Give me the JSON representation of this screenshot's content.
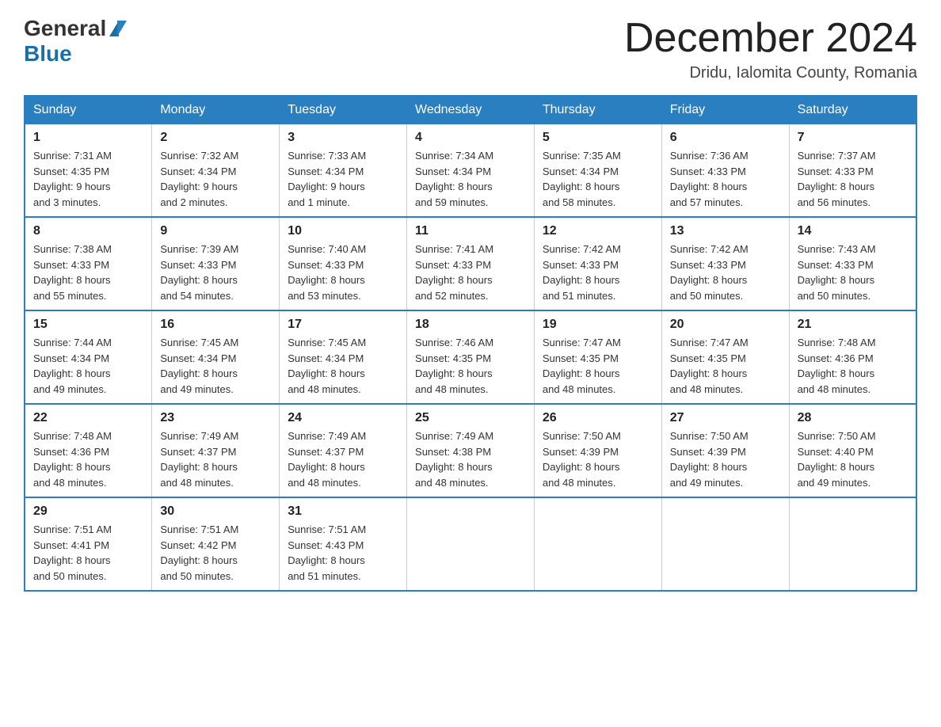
{
  "logo": {
    "general": "General",
    "blue": "Blue"
  },
  "title": "December 2024",
  "subtitle": "Dridu, Ialomita County, Romania",
  "weekdays": [
    "Sunday",
    "Monday",
    "Tuesday",
    "Wednesday",
    "Thursday",
    "Friday",
    "Saturday"
  ],
  "weeks": [
    [
      {
        "day": "1",
        "sunrise": "7:31 AM",
        "sunset": "4:35 PM",
        "daylight": "9 hours and 3 minutes."
      },
      {
        "day": "2",
        "sunrise": "7:32 AM",
        "sunset": "4:34 PM",
        "daylight": "9 hours and 2 minutes."
      },
      {
        "day": "3",
        "sunrise": "7:33 AM",
        "sunset": "4:34 PM",
        "daylight": "9 hours and 1 minute."
      },
      {
        "day": "4",
        "sunrise": "7:34 AM",
        "sunset": "4:34 PM",
        "daylight": "8 hours and 59 minutes."
      },
      {
        "day": "5",
        "sunrise": "7:35 AM",
        "sunset": "4:34 PM",
        "daylight": "8 hours and 58 minutes."
      },
      {
        "day": "6",
        "sunrise": "7:36 AM",
        "sunset": "4:33 PM",
        "daylight": "8 hours and 57 minutes."
      },
      {
        "day": "7",
        "sunrise": "7:37 AM",
        "sunset": "4:33 PM",
        "daylight": "8 hours and 56 minutes."
      }
    ],
    [
      {
        "day": "8",
        "sunrise": "7:38 AM",
        "sunset": "4:33 PM",
        "daylight": "8 hours and 55 minutes."
      },
      {
        "day": "9",
        "sunrise": "7:39 AM",
        "sunset": "4:33 PM",
        "daylight": "8 hours and 54 minutes."
      },
      {
        "day": "10",
        "sunrise": "7:40 AM",
        "sunset": "4:33 PM",
        "daylight": "8 hours and 53 minutes."
      },
      {
        "day": "11",
        "sunrise": "7:41 AM",
        "sunset": "4:33 PM",
        "daylight": "8 hours and 52 minutes."
      },
      {
        "day": "12",
        "sunrise": "7:42 AM",
        "sunset": "4:33 PM",
        "daylight": "8 hours and 51 minutes."
      },
      {
        "day": "13",
        "sunrise": "7:42 AM",
        "sunset": "4:33 PM",
        "daylight": "8 hours and 50 minutes."
      },
      {
        "day": "14",
        "sunrise": "7:43 AM",
        "sunset": "4:33 PM",
        "daylight": "8 hours and 50 minutes."
      }
    ],
    [
      {
        "day": "15",
        "sunrise": "7:44 AM",
        "sunset": "4:34 PM",
        "daylight": "8 hours and 49 minutes."
      },
      {
        "day": "16",
        "sunrise": "7:45 AM",
        "sunset": "4:34 PM",
        "daylight": "8 hours and 49 minutes."
      },
      {
        "day": "17",
        "sunrise": "7:45 AM",
        "sunset": "4:34 PM",
        "daylight": "8 hours and 48 minutes."
      },
      {
        "day": "18",
        "sunrise": "7:46 AM",
        "sunset": "4:35 PM",
        "daylight": "8 hours and 48 minutes."
      },
      {
        "day": "19",
        "sunrise": "7:47 AM",
        "sunset": "4:35 PM",
        "daylight": "8 hours and 48 minutes."
      },
      {
        "day": "20",
        "sunrise": "7:47 AM",
        "sunset": "4:35 PM",
        "daylight": "8 hours and 48 minutes."
      },
      {
        "day": "21",
        "sunrise": "7:48 AM",
        "sunset": "4:36 PM",
        "daylight": "8 hours and 48 minutes."
      }
    ],
    [
      {
        "day": "22",
        "sunrise": "7:48 AM",
        "sunset": "4:36 PM",
        "daylight": "8 hours and 48 minutes."
      },
      {
        "day": "23",
        "sunrise": "7:49 AM",
        "sunset": "4:37 PM",
        "daylight": "8 hours and 48 minutes."
      },
      {
        "day": "24",
        "sunrise": "7:49 AM",
        "sunset": "4:37 PM",
        "daylight": "8 hours and 48 minutes."
      },
      {
        "day": "25",
        "sunrise": "7:49 AM",
        "sunset": "4:38 PM",
        "daylight": "8 hours and 48 minutes."
      },
      {
        "day": "26",
        "sunrise": "7:50 AM",
        "sunset": "4:39 PM",
        "daylight": "8 hours and 48 minutes."
      },
      {
        "day": "27",
        "sunrise": "7:50 AM",
        "sunset": "4:39 PM",
        "daylight": "8 hours and 49 minutes."
      },
      {
        "day": "28",
        "sunrise": "7:50 AM",
        "sunset": "4:40 PM",
        "daylight": "8 hours and 49 minutes."
      }
    ],
    [
      {
        "day": "29",
        "sunrise": "7:51 AM",
        "sunset": "4:41 PM",
        "daylight": "8 hours and 50 minutes."
      },
      {
        "day": "30",
        "sunrise": "7:51 AM",
        "sunset": "4:42 PM",
        "daylight": "8 hours and 50 minutes."
      },
      {
        "day": "31",
        "sunrise": "7:51 AM",
        "sunset": "4:43 PM",
        "daylight": "8 hours and 51 minutes."
      },
      null,
      null,
      null,
      null
    ]
  ],
  "labels": {
    "sunrise": "Sunrise:",
    "sunset": "Sunset:",
    "daylight": "Daylight:"
  }
}
